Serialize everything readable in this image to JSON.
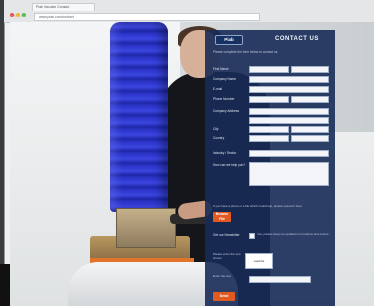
{
  "browser": {
    "tab_title": "Piab Vaculex Contact",
    "address": "www.piab.com/contact"
  },
  "form": {
    "logo": "Piab",
    "title": "CONTACT US",
    "intro": "Please complete the form below to contact us.",
    "fields": [
      {
        "label": "First Name"
      },
      {
        "label": "Company Name"
      },
      {
        "label": "E-mail"
      },
      {
        "label": "Phone Number"
      },
      {
        "label": "Company Address"
      }
    ],
    "city_label": "City",
    "country_label": "Country",
    "industry_label": "Industry / Sector",
    "message_label": "How can we help you?",
    "upload_hint": "If you have a photo or a file which could help, please upload it here:",
    "upload_button": "Browse File",
    "newsletter_label": "Get our Newsletter",
    "newsletter_text": "Yes, please keep me updated on products and events",
    "captcha_label": "Please enter the text shown",
    "captcha_text": "captcha",
    "captcha_field_label": "Enter the text",
    "submit_label": "Send"
  },
  "colors": {
    "panel": "#172b56",
    "accent": "#e05a22",
    "hose": "#2c35c9"
  }
}
